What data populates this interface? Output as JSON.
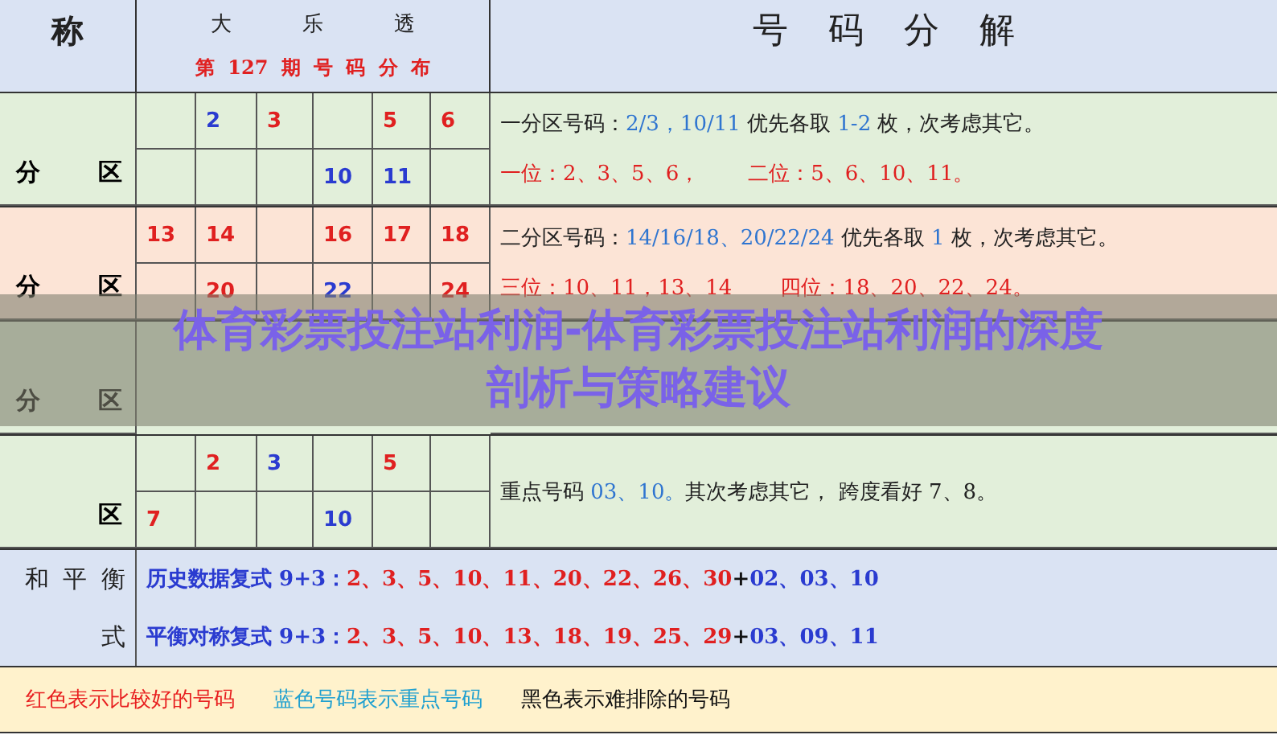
{
  "header": {
    "corner": "称",
    "game": "大 乐 透",
    "issue": "第 127 期 号 码 分 布",
    "analysis_title": "号 码 分 解"
  },
  "zones": [
    {
      "color": "#e2efda",
      "label": [
        "分",
        "区"
      ],
      "rows": [
        [
          null,
          {
            "n": "2",
            "color": "#2a3bd0"
          },
          {
            "n": "3",
            "color": "#e02020"
          },
          null,
          {
            "n": "5",
            "color": "#e02020"
          },
          {
            "n": "6",
            "color": "#e02020"
          }
        ],
        [
          null,
          null,
          null,
          {
            "n": "10",
            "color": "#2a3bd0"
          },
          {
            "n": "11",
            "color": "#2a3bd0"
          },
          null
        ]
      ],
      "lines": [
        [
          {
            "t": "一分区号码：",
            "color": "#222222"
          },
          {
            "t": "2/3，10/11",
            "color": "#2f75d0"
          },
          {
            "t": " 优先各取 ",
            "color": "#222222"
          },
          {
            "t": "1-2",
            "color": "#2f75d0"
          },
          {
            "t": " 枚，次考虑其它。",
            "color": "#222222"
          }
        ],
        [
          {
            "t": "一位：2、3、5、6，",
            "color": "#e02020"
          },
          {
            "t": "二位：5、6、10、11。",
            "color": "#e02020"
          }
        ]
      ]
    },
    {
      "color": "#fce4d6",
      "label": [
        "分",
        "区"
      ],
      "rows": [
        [
          {
            "n": "13",
            "color": "#e02020"
          },
          {
            "n": "14",
            "color": "#e02020"
          },
          null,
          {
            "n": "16",
            "color": "#e02020"
          },
          {
            "n": "17",
            "color": "#e02020"
          },
          {
            "n": "18",
            "color": "#e02020"
          }
        ],
        [
          null,
          {
            "n": "20",
            "color": "#e02020"
          },
          null,
          {
            "n": "22",
            "color": "#2a3bd0"
          },
          null,
          {
            "n": "24",
            "color": "#e02020"
          }
        ]
      ],
      "lines": [
        [
          {
            "t": "二分区号码：",
            "color": "#222222"
          },
          {
            "t": "14/16/18、20/22/24",
            "color": "#2f75d0"
          },
          {
            "t": " 优先各取 ",
            "color": "#222222"
          },
          {
            "t": "1",
            "color": "#2f75d0"
          },
          {
            "t": " 枚，次考虑其它。",
            "color": "#222222"
          }
        ],
        [
          {
            "t": "三位：10、11，13、14",
            "color": "#e02020"
          },
          {
            "t": "四位：18、20、22、24。",
            "color": "#e02020"
          }
        ]
      ]
    },
    {
      "color": "#e2efda",
      "label": [
        "分",
        "区"
      ]
    },
    {
      "color": "#e2efda",
      "label": [
        "区"
      ],
      "rows": [
        [
          null,
          {
            "n": "2",
            "color": "#e02020"
          },
          {
            "n": "3",
            "color": "#2a3bd0"
          },
          null,
          {
            "n": "5",
            "color": "#e02020"
          },
          null
        ],
        [
          {
            "n": "7",
            "color": "#e02020"
          },
          null,
          null,
          {
            "n": "10",
            "color": "#2a3bd0"
          },
          null,
          null
        ]
      ],
      "lines": [
        [
          {
            "t": "重点号码 ",
            "color": "#222222"
          },
          {
            "t": "03、10。",
            "color": "#2f75d0"
          },
          {
            "t": "其次考虑其它，  跨度看好 ",
            "color": "#222222"
          },
          {
            "t": "7、8。",
            "color": "#222222"
          }
        ]
      ]
    }
  ],
  "combos": {
    "label": [
      "和 平 衡",
      "式"
    ],
    "lines": [
      [
        {
          "t": "历史数据复式 9+3：",
          "color": "#2a3bd0"
        },
        {
          "t": "2、3、5、10、11、20、22、26、30",
          "color": "#e02020"
        },
        {
          "t": "+",
          "color": "#111111"
        },
        {
          "t": "02、03、10",
          "color": "#2a3bd0"
        }
      ],
      [
        {
          "t": "平衡对称复式 9+3：",
          "color": "#2a3bd0"
        },
        {
          "t": "2、3、5、10、13、18、19、25、29",
          "color": "#e02020"
        },
        {
          "t": "+",
          "color": "#111111"
        },
        {
          "t": "03、09、11",
          "color": "#2a3bd0"
        }
      ]
    ]
  },
  "legend": [
    {
      "text": "红色表示比较好的号码",
      "color": "#e82020"
    },
    {
      "text": "蓝色号码表示重点号码",
      "color": "#1fa0d0"
    },
    {
      "text": "黑色表示难排除的号码",
      "color": "#111111"
    }
  ],
  "overlay_title": [
    "体育彩票投注站利润-体育彩票投注站利润的深度",
    "剖析与策略建议"
  ]
}
